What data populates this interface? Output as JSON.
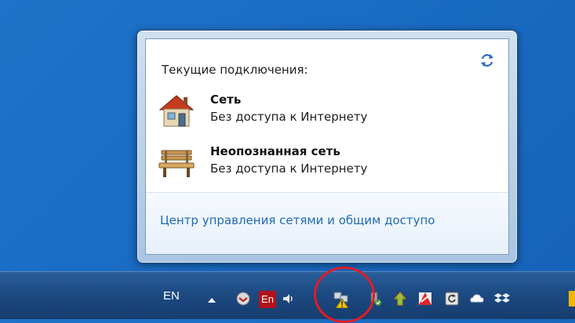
{
  "popup": {
    "title": "Текущие подключения:",
    "connections": [
      {
        "name": "Сеть",
        "status": "Без доступа к Интернету",
        "icon": "house-icon"
      },
      {
        "name": "Неопознанная сеть",
        "status": "Без доступа к Интернету",
        "icon": "bench-icon"
      }
    ],
    "footer_link": "Центр управления сетями и общим доступо"
  },
  "taskbar": {
    "language": "EN",
    "tray_icons": [
      "show-hidden-icons-arrow",
      "network-status-icon",
      "en-keyboard-icon",
      "volume-icon",
      "network-warning-icon",
      "usb-safe-remove-icon",
      "update-arrow-icon",
      "antivirus-icon",
      "refresh-app-icon",
      "onedrive-cloud-icon",
      "dropbox-icon"
    ],
    "en_badge": "En"
  },
  "colors": {
    "desktop": "#1a6cc4",
    "link": "#1f6ab5",
    "highlight": "#e31b23"
  }
}
